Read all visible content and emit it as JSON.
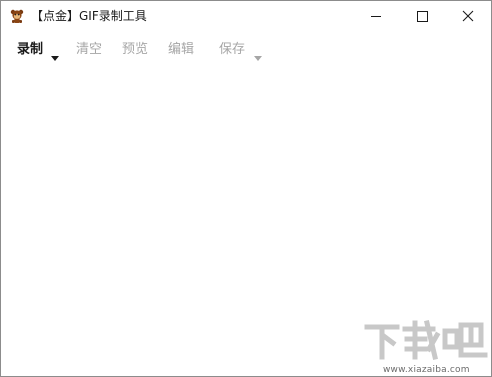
{
  "window": {
    "title": "【点金】GIF录制工具",
    "app_icon": "monkey-icon",
    "controls": {
      "minimize": "minimize-icon",
      "maximize": "maximize-icon",
      "close": "close-icon"
    }
  },
  "toolbar": {
    "record_label": "录制",
    "clear_label": "清空",
    "preview_label": "预览",
    "edit_label": "编辑",
    "save_label": "保存"
  },
  "colors": {
    "enabled_text": "#1a1a1a",
    "disabled_text": "#a6a6a6",
    "border": "#8c8c8c"
  },
  "watermark": {
    "brand_logo": "下载吧",
    "url": "www.xiazaiba.com"
  }
}
